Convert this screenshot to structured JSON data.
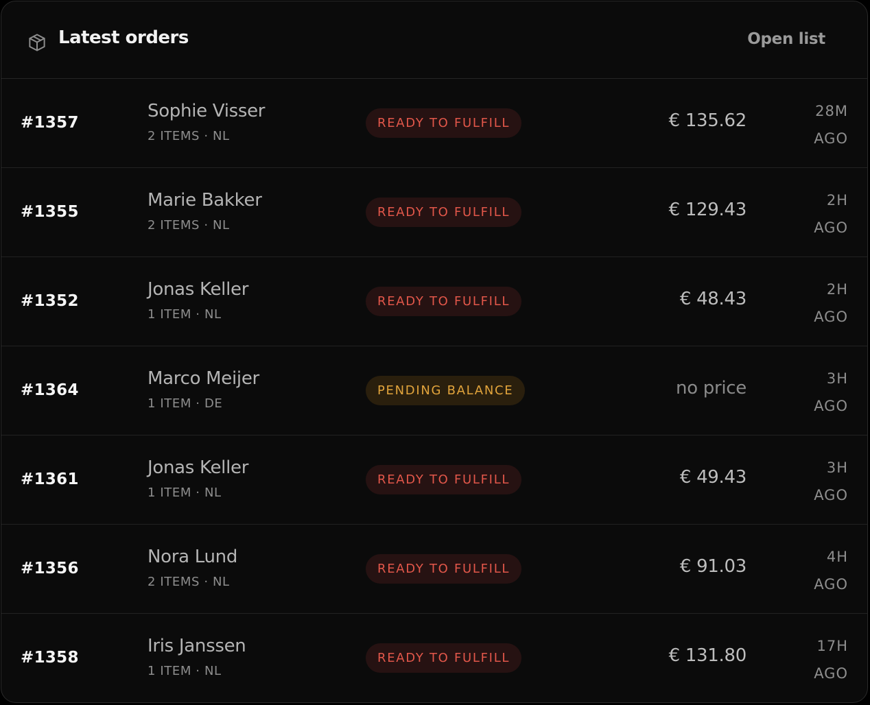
{
  "header": {
    "icon": "box-icon",
    "title": "Latest orders",
    "open_list_label": "Open list"
  },
  "orders": [
    {
      "id": "#1357",
      "customer": "Sophie Visser",
      "meta": "2 ITEMS · NL",
      "status": "READY TO FULFILL",
      "status_type": "ready",
      "price": "€ 135.62",
      "time_value": "28M",
      "time_suffix": "AGO"
    },
    {
      "id": "#1355",
      "customer": "Marie Bakker",
      "meta": "2 ITEMS · NL",
      "status": "READY TO FULFILL",
      "status_type": "ready",
      "price": "€ 129.43",
      "time_value": "2H",
      "time_suffix": "AGO"
    },
    {
      "id": "#1352",
      "customer": "Jonas Keller",
      "meta": "1 ITEM · NL",
      "status": "READY TO FULFILL",
      "status_type": "ready",
      "price": "€ 48.43",
      "time_value": "2H",
      "time_suffix": "AGO"
    },
    {
      "id": "#1364",
      "customer": "Marco Meijer",
      "meta": "1 ITEM · DE",
      "status": "PENDING BALANCE",
      "status_type": "pending",
      "price": "no price",
      "time_value": "3H",
      "time_suffix": "AGO"
    },
    {
      "id": "#1361",
      "customer": "Jonas Keller",
      "meta": "1 ITEM · NL",
      "status": "READY TO FULFILL",
      "status_type": "ready",
      "price": "€ 49.43",
      "time_value": "3H",
      "time_suffix": "AGO"
    },
    {
      "id": "#1356",
      "customer": "Nora Lund",
      "meta": "2 ITEMS · NL",
      "status": "READY TO FULFILL",
      "status_type": "ready",
      "price": "€ 91.03",
      "time_value": "4H",
      "time_suffix": "AGO"
    },
    {
      "id": "#1358",
      "customer": "Iris Janssen",
      "meta": "1 ITEM · NL",
      "status": "READY TO FULFILL",
      "status_type": "ready",
      "price": "€ 131.80",
      "time_value": "17H",
      "time_suffix": "AGO"
    }
  ],
  "colors": {
    "background": "#0b0b0b",
    "ready_text": "#e2574a",
    "ready_bg": "#261212",
    "pending_text": "#e2a43c",
    "pending_bg": "#2a1f0d"
  }
}
